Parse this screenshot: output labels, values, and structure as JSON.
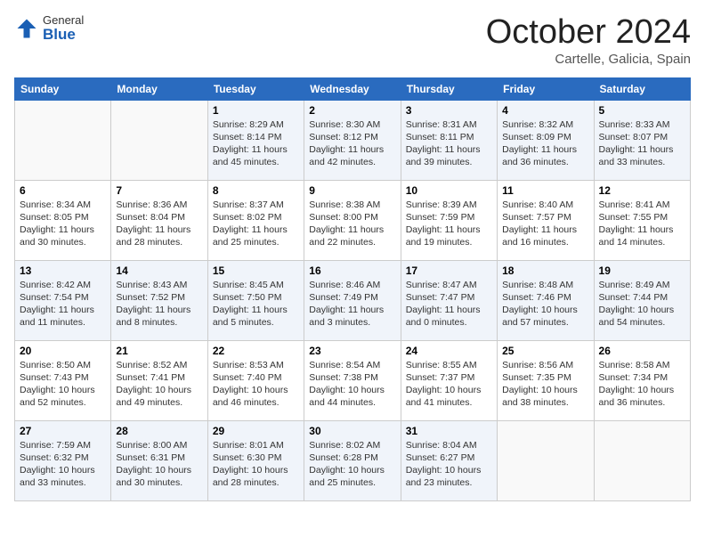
{
  "header": {
    "logo": {
      "general": "General",
      "blue": "Blue"
    },
    "title": "October 2024",
    "location": "Cartelle, Galicia, Spain"
  },
  "columns": [
    "Sunday",
    "Monday",
    "Tuesday",
    "Wednesday",
    "Thursday",
    "Friday",
    "Saturday"
  ],
  "weeks": [
    [
      {
        "day": "",
        "sunrise": "",
        "sunset": "",
        "daylight": ""
      },
      {
        "day": "",
        "sunrise": "",
        "sunset": "",
        "daylight": ""
      },
      {
        "day": "1",
        "sunrise": "Sunrise: 8:29 AM",
        "sunset": "Sunset: 8:14 PM",
        "daylight": "Daylight: 11 hours and 45 minutes."
      },
      {
        "day": "2",
        "sunrise": "Sunrise: 8:30 AM",
        "sunset": "Sunset: 8:12 PM",
        "daylight": "Daylight: 11 hours and 42 minutes."
      },
      {
        "day": "3",
        "sunrise": "Sunrise: 8:31 AM",
        "sunset": "Sunset: 8:11 PM",
        "daylight": "Daylight: 11 hours and 39 minutes."
      },
      {
        "day": "4",
        "sunrise": "Sunrise: 8:32 AM",
        "sunset": "Sunset: 8:09 PM",
        "daylight": "Daylight: 11 hours and 36 minutes."
      },
      {
        "day": "5",
        "sunrise": "Sunrise: 8:33 AM",
        "sunset": "Sunset: 8:07 PM",
        "daylight": "Daylight: 11 hours and 33 minutes."
      }
    ],
    [
      {
        "day": "6",
        "sunrise": "Sunrise: 8:34 AM",
        "sunset": "Sunset: 8:05 PM",
        "daylight": "Daylight: 11 hours and 30 minutes."
      },
      {
        "day": "7",
        "sunrise": "Sunrise: 8:36 AM",
        "sunset": "Sunset: 8:04 PM",
        "daylight": "Daylight: 11 hours and 28 minutes."
      },
      {
        "day": "8",
        "sunrise": "Sunrise: 8:37 AM",
        "sunset": "Sunset: 8:02 PM",
        "daylight": "Daylight: 11 hours and 25 minutes."
      },
      {
        "day": "9",
        "sunrise": "Sunrise: 8:38 AM",
        "sunset": "Sunset: 8:00 PM",
        "daylight": "Daylight: 11 hours and 22 minutes."
      },
      {
        "day": "10",
        "sunrise": "Sunrise: 8:39 AM",
        "sunset": "Sunset: 7:59 PM",
        "daylight": "Daylight: 11 hours and 19 minutes."
      },
      {
        "day": "11",
        "sunrise": "Sunrise: 8:40 AM",
        "sunset": "Sunset: 7:57 PM",
        "daylight": "Daylight: 11 hours and 16 minutes."
      },
      {
        "day": "12",
        "sunrise": "Sunrise: 8:41 AM",
        "sunset": "Sunset: 7:55 PM",
        "daylight": "Daylight: 11 hours and 14 minutes."
      }
    ],
    [
      {
        "day": "13",
        "sunrise": "Sunrise: 8:42 AM",
        "sunset": "Sunset: 7:54 PM",
        "daylight": "Daylight: 11 hours and 11 minutes."
      },
      {
        "day": "14",
        "sunrise": "Sunrise: 8:43 AM",
        "sunset": "Sunset: 7:52 PM",
        "daylight": "Daylight: 11 hours and 8 minutes."
      },
      {
        "day": "15",
        "sunrise": "Sunrise: 8:45 AM",
        "sunset": "Sunset: 7:50 PM",
        "daylight": "Daylight: 11 hours and 5 minutes."
      },
      {
        "day": "16",
        "sunrise": "Sunrise: 8:46 AM",
        "sunset": "Sunset: 7:49 PM",
        "daylight": "Daylight: 11 hours and 3 minutes."
      },
      {
        "day": "17",
        "sunrise": "Sunrise: 8:47 AM",
        "sunset": "Sunset: 7:47 PM",
        "daylight": "Daylight: 11 hours and 0 minutes."
      },
      {
        "day": "18",
        "sunrise": "Sunrise: 8:48 AM",
        "sunset": "Sunset: 7:46 PM",
        "daylight": "Daylight: 10 hours and 57 minutes."
      },
      {
        "day": "19",
        "sunrise": "Sunrise: 8:49 AM",
        "sunset": "Sunset: 7:44 PM",
        "daylight": "Daylight: 10 hours and 54 minutes."
      }
    ],
    [
      {
        "day": "20",
        "sunrise": "Sunrise: 8:50 AM",
        "sunset": "Sunset: 7:43 PM",
        "daylight": "Daylight: 10 hours and 52 minutes."
      },
      {
        "day": "21",
        "sunrise": "Sunrise: 8:52 AM",
        "sunset": "Sunset: 7:41 PM",
        "daylight": "Daylight: 10 hours and 49 minutes."
      },
      {
        "day": "22",
        "sunrise": "Sunrise: 8:53 AM",
        "sunset": "Sunset: 7:40 PM",
        "daylight": "Daylight: 10 hours and 46 minutes."
      },
      {
        "day": "23",
        "sunrise": "Sunrise: 8:54 AM",
        "sunset": "Sunset: 7:38 PM",
        "daylight": "Daylight: 10 hours and 44 minutes."
      },
      {
        "day": "24",
        "sunrise": "Sunrise: 8:55 AM",
        "sunset": "Sunset: 7:37 PM",
        "daylight": "Daylight: 10 hours and 41 minutes."
      },
      {
        "day": "25",
        "sunrise": "Sunrise: 8:56 AM",
        "sunset": "Sunset: 7:35 PM",
        "daylight": "Daylight: 10 hours and 38 minutes."
      },
      {
        "day": "26",
        "sunrise": "Sunrise: 8:58 AM",
        "sunset": "Sunset: 7:34 PM",
        "daylight": "Daylight: 10 hours and 36 minutes."
      }
    ],
    [
      {
        "day": "27",
        "sunrise": "Sunrise: 7:59 AM",
        "sunset": "Sunset: 6:32 PM",
        "daylight": "Daylight: 10 hours and 33 minutes."
      },
      {
        "day": "28",
        "sunrise": "Sunrise: 8:00 AM",
        "sunset": "Sunset: 6:31 PM",
        "daylight": "Daylight: 10 hours and 30 minutes."
      },
      {
        "day": "29",
        "sunrise": "Sunrise: 8:01 AM",
        "sunset": "Sunset: 6:30 PM",
        "daylight": "Daylight: 10 hours and 28 minutes."
      },
      {
        "day": "30",
        "sunrise": "Sunrise: 8:02 AM",
        "sunset": "Sunset: 6:28 PM",
        "daylight": "Daylight: 10 hours and 25 minutes."
      },
      {
        "day": "31",
        "sunrise": "Sunrise: 8:04 AM",
        "sunset": "Sunset: 6:27 PM",
        "daylight": "Daylight: 10 hours and 23 minutes."
      },
      {
        "day": "",
        "sunrise": "",
        "sunset": "",
        "daylight": ""
      },
      {
        "day": "",
        "sunrise": "",
        "sunset": "",
        "daylight": ""
      }
    ]
  ]
}
